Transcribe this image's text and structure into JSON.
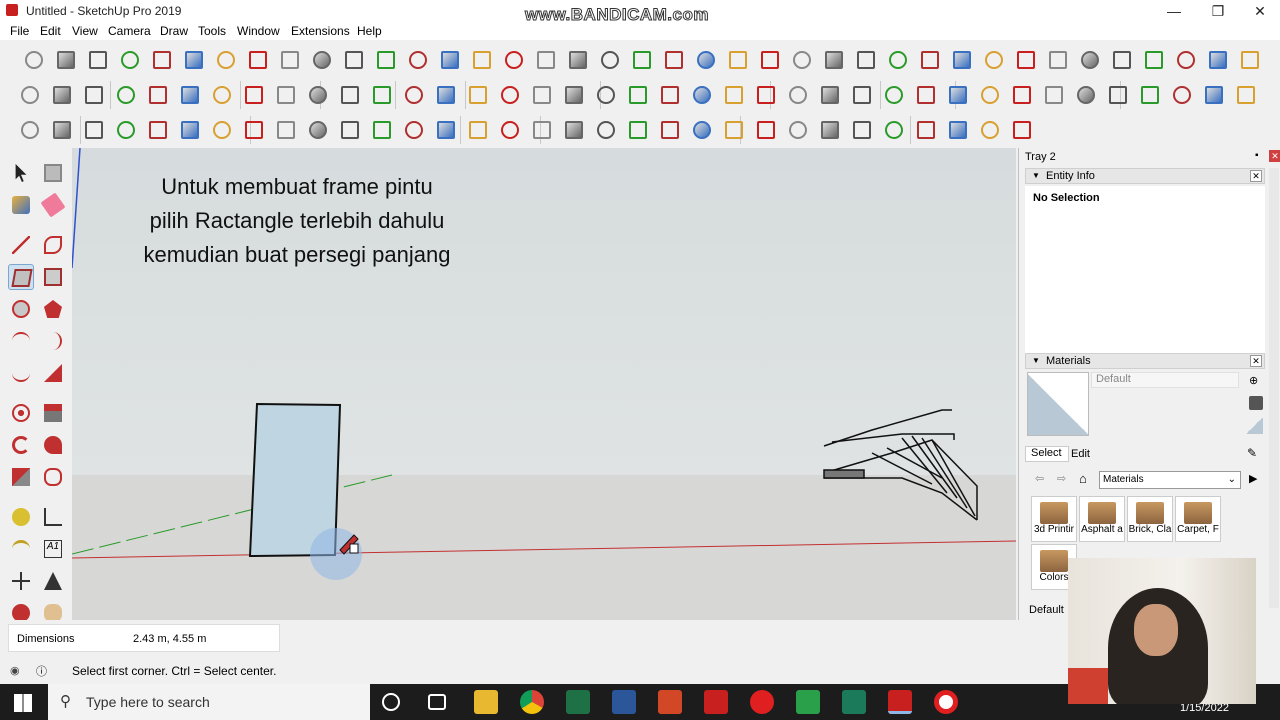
{
  "window": {
    "title": "Untitled - SketchUp Pro 2019",
    "watermark": "www.BANDICAM.com",
    "minimize": "—",
    "maximize": "❐",
    "close": "✕"
  },
  "menu": [
    "File",
    "Edit",
    "View",
    "Camera",
    "Draw",
    "Tools",
    "Window",
    "Extensions",
    "Help"
  ],
  "overlay_text": [
    "Untuk membuat frame pintu",
    "pilih Ractangle terlebih dahulu",
    "kemudian buat persegi panjang"
  ],
  "tray": {
    "title": "Tray 2",
    "entity_info": {
      "header": "Entity Info",
      "selection": "No Selection"
    },
    "materials": {
      "header": "Materials",
      "name_placeholder": "Default",
      "tabs": [
        "Select",
        "Edit"
      ],
      "collection": "Materials",
      "swatches": [
        "3d Printir",
        "Asphalt a",
        "Brick, Cla",
        "Carpet, F",
        "Colors"
      ],
      "footer": "Default"
    }
  },
  "status": {
    "measurement_label": "Dimensions",
    "measurement_value": "2.43 m, 4.55 m",
    "hint": "Select first corner. Ctrl = Select center."
  },
  "taskbar": {
    "search_placeholder": "Type here to search",
    "date": "1/15/2022"
  },
  "colors": {
    "accent_red": "#c8201e",
    "sky": "#d9dfe0",
    "ground": "#d7d8d6",
    "rect_fill": "#bfd6e2"
  }
}
